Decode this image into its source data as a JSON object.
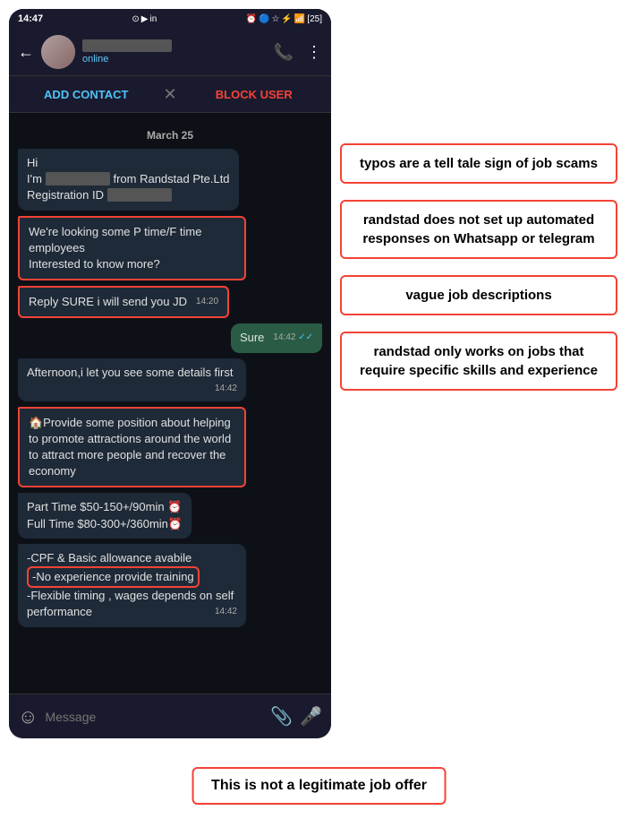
{
  "status_bar": {
    "time": "14:47",
    "right_icons": "📶 25"
  },
  "nav": {
    "contact_status": "online",
    "phone_icon": "📞",
    "more_icon": "⋮"
  },
  "action_bar": {
    "add_label": "ADD CONTACT",
    "block_label": "BLOCK USER",
    "divider": "✕"
  },
  "chat": {
    "date_label": "March 25",
    "messages": [
      {
        "type": "incoming",
        "text": "Hi\nI'm [REDACTED] from Randstad Pte.Ltd\nRegistration ID [REDACTED]",
        "time": "",
        "highlight": false
      },
      {
        "type": "incoming",
        "text": "We're looking some P time/F time employees\nInterested to know more?",
        "time": "",
        "highlight": true
      },
      {
        "type": "incoming",
        "text": "Reply SURE i will send you JD",
        "time": "14:20",
        "highlight": true
      },
      {
        "type": "outgoing",
        "text": "Sure",
        "time": "14:42",
        "ticks": "✓✓",
        "highlight": false
      },
      {
        "type": "incoming",
        "text": "Afternoon,i let you see some details first",
        "time": "14:42",
        "highlight": false
      },
      {
        "type": "incoming",
        "text": "🏠Provide some position about helping to promote attractions around the world to attract more people and recover the economy",
        "time": "",
        "highlight": true
      },
      {
        "type": "incoming",
        "text": "Part Time $50-150+/90min ⏰\nFull  Time $80-300+/360min⏰",
        "time": "",
        "highlight": false
      },
      {
        "type": "incoming",
        "text": "-CPF & Basic allowance avabile\n-No experience provide training\n-Flexible timing , wages depends on self performance",
        "time": "14:42",
        "highlight": true,
        "partial_highlight": true
      }
    ]
  },
  "input_bar": {
    "placeholder": "Message"
  },
  "annotations": [
    {
      "id": "annotation-typos",
      "text": "typos are a tell tale sign of job scams"
    },
    {
      "id": "annotation-automated",
      "text": "randstad does not set up automated responses on Whatsapp or telegram"
    },
    {
      "id": "annotation-vague",
      "text": "vague job descriptions"
    },
    {
      "id": "annotation-skills",
      "text": "randstad only works on jobs that require specific skills and experience"
    }
  ],
  "bottom_notice": {
    "text": "This is not a legitimate job offer"
  }
}
